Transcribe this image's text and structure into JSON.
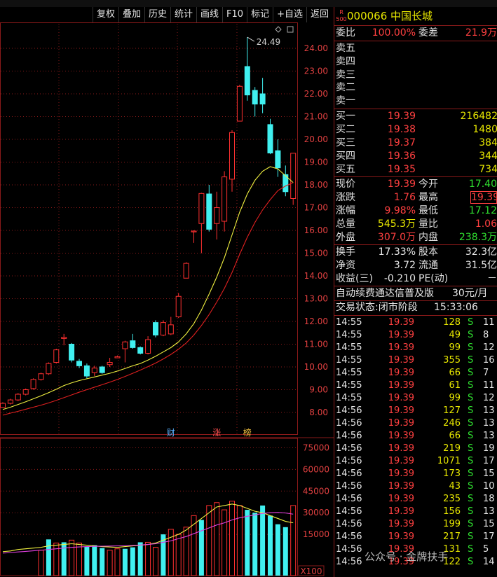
{
  "toolbar": {
    "items": [
      "复权",
      "叠加",
      "历史",
      "统计",
      "画线",
      "F10",
      "标记",
      "+自选",
      "返回"
    ]
  },
  "chart": {
    "price_ticks": [
      "24.00",
      "23.00",
      "22.00",
      "21.00",
      "20.00",
      "19.00",
      "18.00",
      "17.00",
      "16.00",
      "15.00",
      "14.00",
      "13.00",
      "12.00",
      "11.00",
      "10.00",
      "9.00",
      "8.00"
    ],
    "vol_ticks": [
      "75000",
      "60000",
      "45000",
      "30000",
      "15000"
    ],
    "vol_unit": "X100",
    "high_annotation": "24.49",
    "markers": [
      "财",
      "涨",
      "榜"
    ]
  },
  "chart_data": {
    "type": "candlestick",
    "candles": [
      {
        "o": 8.22,
        "c": 8.4,
        "h": 8.45,
        "l": 8.2
      },
      {
        "o": 8.4,
        "c": 8.55,
        "h": 8.6,
        "l": 8.35
      },
      {
        "o": 8.55,
        "c": 8.8,
        "h": 8.85,
        "l": 8.5
      },
      {
        "o": 8.8,
        "c": 9.0,
        "h": 9.05,
        "l": 8.75
      },
      {
        "o": 9.05,
        "c": 9.45,
        "h": 9.5,
        "l": 9.0
      },
      {
        "o": 9.45,
        "c": 9.7,
        "h": 9.75,
        "l": 9.4
      },
      {
        "o": 9.7,
        "c": 10.15,
        "h": 10.2,
        "l": 9.65
      },
      {
        "o": 10.2,
        "c": 10.75,
        "h": 10.8,
        "l": 10.15
      },
      {
        "o": 11.25,
        "c": 11.3,
        "h": 11.45,
        "l": 10.95
      },
      {
        "o": 11.0,
        "c": 10.3,
        "h": 11.05,
        "l": 10.2
      },
      {
        "o": 10.25,
        "c": 10.05,
        "h": 10.35,
        "l": 9.95
      },
      {
        "o": 10.05,
        "c": 9.6,
        "h": 10.15,
        "l": 9.5
      },
      {
        "o": 9.75,
        "c": 9.95,
        "h": 10.05,
        "l": 9.6
      },
      {
        "o": 10.0,
        "c": 9.75,
        "h": 10.05,
        "l": 9.7
      },
      {
        "o": 10.1,
        "c": 10.2,
        "h": 10.4,
        "l": 10.0
      },
      {
        "o": 10.4,
        "c": 10.45,
        "h": 10.5,
        "l": 10.4
      },
      {
        "o": 10.8,
        "c": 11.1,
        "h": 11.15,
        "l": 10.2
      },
      {
        "o": 11.15,
        "c": 10.85,
        "h": 11.45,
        "l": 10.8
      },
      {
        "o": 10.85,
        "c": 10.6,
        "h": 10.9,
        "l": 10.55
      },
      {
        "o": 10.6,
        "c": 11.2,
        "h": 11.35,
        "l": 10.55
      },
      {
        "o": 11.95,
        "c": 11.4,
        "h": 12.05,
        "l": 11.3
      },
      {
        "o": 11.4,
        "c": 11.95,
        "h": 12.05,
        "l": 11.35
      },
      {
        "o": 11.45,
        "c": 11.85,
        "h": 12.2,
        "l": 11.4
      },
      {
        "o": 12.2,
        "c": 13.1,
        "h": 13.25,
        "l": 12.15
      },
      {
        "o": 13.9,
        "c": 14.55,
        "h": 14.6,
        "l": 13.9
      },
      {
        "o": 15.97,
        "c": 15.97,
        "h": 16.0,
        "l": 15.45
      },
      {
        "o": 16.3,
        "c": 17.62,
        "h": 17.65,
        "l": 15.0
      },
      {
        "o": 17.6,
        "c": 16.05,
        "h": 18.0,
        "l": 15.95
      },
      {
        "o": 16.3,
        "c": 17.0,
        "h": 17.7,
        "l": 15.6
      },
      {
        "o": 16.4,
        "c": 18.35,
        "h": 18.6,
        "l": 15.95
      },
      {
        "o": 18.25,
        "c": 20.3,
        "h": 20.4,
        "l": 17.7
      },
      {
        "o": 20.8,
        "c": 22.33,
        "h": 22.4,
        "l": 20.9
      },
      {
        "o": 23.2,
        "c": 21.95,
        "h": 24.49,
        "l": 21.7
      },
      {
        "o": 22.15,
        "c": 21.55,
        "h": 22.3,
        "l": 21.0
      },
      {
        "o": 22.0,
        "c": 21.55,
        "h": 22.7,
        "l": 21.15
      },
      {
        "o": 20.65,
        "c": 19.4,
        "h": 20.9,
        "l": 19.35
      },
      {
        "o": 19.5,
        "c": 18.75,
        "h": 20.0,
        "l": 18.35
      },
      {
        "o": 18.45,
        "c": 17.7,
        "h": 18.85,
        "l": 17.5
      },
      {
        "o": 17.4,
        "c": 19.39,
        "h": 19.39,
        "l": 17.12
      }
    ],
    "ma_yellow": [
      8.13,
      8.23,
      8.35,
      8.47,
      8.6,
      8.73,
      8.87,
      9.02,
      9.18,
      9.3,
      9.4,
      9.48,
      9.56,
      9.64,
      9.72,
      9.82,
      9.93,
      10.05,
      10.15,
      10.3,
      10.47,
      10.66,
      10.85,
      11.1,
      11.45,
      11.9,
      12.5,
      13.2,
      13.95,
      14.8,
      15.8,
      16.8,
      17.6,
      18.2,
      18.6,
      18.8,
      18.7,
      18.4,
      18.1
    ],
    "ma_red": [
      7.88,
      7.97,
      8.05,
      8.14,
      8.23,
      8.32,
      8.42,
      8.53,
      8.65,
      8.77,
      8.89,
      9.0,
      9.11,
      9.22,
      9.33,
      9.45,
      9.58,
      9.72,
      9.86,
      10.01,
      10.17,
      10.35,
      10.55,
      10.78,
      11.05,
      11.4,
      11.82,
      12.3,
      12.85,
      13.45,
      14.15,
      14.95,
      15.7,
      16.35,
      16.9,
      17.35,
      17.75,
      17.95,
      18.1
    ],
    "volume": [
      0,
      0,
      0,
      0,
      0,
      4000,
      11500,
      9000,
      9500,
      11000,
      9000,
      6500,
      7500,
      5500,
      4000,
      5000,
      5000,
      6000,
      9500,
      9500,
      6000,
      15000,
      18500,
      15000,
      20000,
      28000,
      25000,
      35000,
      37000,
      32000,
      38000,
      35000,
      32000,
      30000,
      35000,
      28000,
      22000,
      20000,
      35000
    ],
    "volume_up": [
      true,
      true,
      true,
      true,
      true,
      true,
      false,
      true,
      false,
      true,
      true,
      false,
      false,
      false,
      true,
      true,
      false,
      false,
      false,
      true,
      true,
      false,
      true,
      true,
      true,
      true,
      false,
      true,
      true,
      true,
      true,
      true,
      false,
      false,
      false,
      false,
      false,
      false,
      true
    ],
    "vol_ma_yellow": [
      3000,
      3500,
      4500,
      5000,
      5500,
      6000,
      7000,
      7500,
      8000,
      8500,
      8000,
      7500,
      7000,
      6500,
      6200,
      6000,
      6500,
      7000,
      7500,
      8000,
      9000,
      11000,
      13000,
      15000,
      18000,
      22000,
      26000,
      30000,
      34000,
      35000,
      36000,
      35000,
      33000,
      31000,
      30000,
      28000,
      26000,
      24000,
      23000
    ],
    "vol_ma_purple": [
      2000,
      2300,
      2800,
      3200,
      3600,
      4000,
      4500,
      5000,
      5500,
      6000,
      6300,
      6500,
      6700,
      6800,
      6900,
      7000,
      7100,
      7300,
      7600,
      8000,
      8500,
      9500,
      10500,
      12000,
      13500,
      15500,
      17500,
      19500,
      21500,
      23000,
      25000,
      26500,
      27500,
      28500,
      29500,
      30000,
      30200,
      29800,
      29000
    ]
  },
  "stock": {
    "badge_top": "R",
    "badge_bottom": "500",
    "code_name": "000066 中国长城"
  },
  "quote": {
    "weibi_label": "委比",
    "weibi_value": "100.00%",
    "weicha_label": "委差",
    "weicha_value": "21.9万",
    "sell": [
      {
        "label": "卖五",
        "price": "",
        "vol": ""
      },
      {
        "label": "卖四",
        "price": "",
        "vol": ""
      },
      {
        "label": "卖三",
        "price": "",
        "vol": ""
      },
      {
        "label": "卖二",
        "price": "",
        "vol": ""
      },
      {
        "label": "卖一",
        "price": "",
        "vol": ""
      }
    ],
    "buy": [
      {
        "label": "买一",
        "price": "19.39",
        "vol": "216482"
      },
      {
        "label": "买二",
        "price": "19.38",
        "vol": "1480"
      },
      {
        "label": "买三",
        "price": "19.37",
        "vol": "384"
      },
      {
        "label": "买四",
        "price": "19.36",
        "vol": "344"
      },
      {
        "label": "买五",
        "price": "19.35",
        "vol": "734"
      }
    ],
    "stats": [
      {
        "l1": "现价",
        "v1": "19.39",
        "l2": "今开",
        "v2": "17.40"
      },
      {
        "l1": "涨跌",
        "v1": "1.76",
        "l2": "最高",
        "v2": "19.39"
      },
      {
        "l1": "涨幅",
        "v1": "9.98%",
        "l2": "最低",
        "v2": "17.12"
      },
      {
        "l1": "总量",
        "v1": "545.3万",
        "l2": "量比",
        "v2": "1.06"
      },
      {
        "l1": "外盘",
        "v1": "307.0万",
        "l2": "内盘",
        "v2": "238.3万"
      }
    ],
    "fund": [
      {
        "l1": "换手",
        "v1": "17.33%",
        "l2": "股本",
        "v2": "32.3亿"
      },
      {
        "l1": "净资",
        "v1": "3.72",
        "l2": "流通",
        "v2": "31.5亿"
      },
      {
        "l1": "收益(三)",
        "v1": "-0.210",
        "l2": "PE(动)",
        "v2": "－"
      }
    ],
    "promo_text": "自动续费通达信普及版",
    "promo_price": "30元/月",
    "status_text": "交易状态:闭市阶段",
    "status_time": "15:33:06"
  },
  "ticks": [
    {
      "t": "14:55",
      "p": "19.39",
      "v": "128",
      "s": "S",
      "n": "11"
    },
    {
      "t": "14:55",
      "p": "19.39",
      "v": "49",
      "s": "S",
      "n": "8"
    },
    {
      "t": "14:55",
      "p": "19.39",
      "v": "99",
      "s": "S",
      "n": "12"
    },
    {
      "t": "14:55",
      "p": "19.39",
      "v": "355",
      "s": "S",
      "n": "16"
    },
    {
      "t": "14:55",
      "p": "19.39",
      "v": "66",
      "s": "S",
      "n": "7"
    },
    {
      "t": "14:55",
      "p": "19.39",
      "v": "61",
      "s": "S",
      "n": "11"
    },
    {
      "t": "14:55",
      "p": "19.39",
      "v": "99",
      "s": "S",
      "n": "12"
    },
    {
      "t": "14:56",
      "p": "19.39",
      "v": "127",
      "s": "S",
      "n": "13"
    },
    {
      "t": "14:56",
      "p": "19.39",
      "v": "246",
      "s": "S",
      "n": "13"
    },
    {
      "t": "14:56",
      "p": "19.39",
      "v": "66",
      "s": "S",
      "n": "13"
    },
    {
      "t": "14:56",
      "p": "19.39",
      "v": "219",
      "s": "S",
      "n": "19"
    },
    {
      "t": "14:56",
      "p": "19.39",
      "v": "1071",
      "s": "S",
      "n": "17"
    },
    {
      "t": "14:56",
      "p": "19.39",
      "v": "173",
      "s": "S",
      "n": "15"
    },
    {
      "t": "14:56",
      "p": "19.39",
      "v": "43",
      "s": "S",
      "n": "10"
    },
    {
      "t": "14:56",
      "p": "19.39",
      "v": "235",
      "s": "S",
      "n": "18"
    },
    {
      "t": "14:56",
      "p": "19.39",
      "v": "156",
      "s": "S",
      "n": "13"
    },
    {
      "t": "14:56",
      "p": "19.39",
      "v": "199",
      "s": "S",
      "n": "15"
    },
    {
      "t": "14:56",
      "p": "19.39",
      "v": "217",
      "s": "S",
      "n": "17"
    },
    {
      "t": "14:56",
      "p": "19.39",
      "v": "131",
      "s": "S",
      "n": "5"
    },
    {
      "t": "14:56",
      "p": "19.39",
      "v": "122",
      "s": "S",
      "n": "14"
    }
  ],
  "watermark": "公众号 · 金牌扶手",
  "colors": {
    "up": "#ff3030",
    "down": "#40f0f0",
    "ma5": "#f0f040",
    "ma10": "#e02020",
    "vol_ma2": "#e040e0",
    "grid": "#8a1a1a"
  }
}
